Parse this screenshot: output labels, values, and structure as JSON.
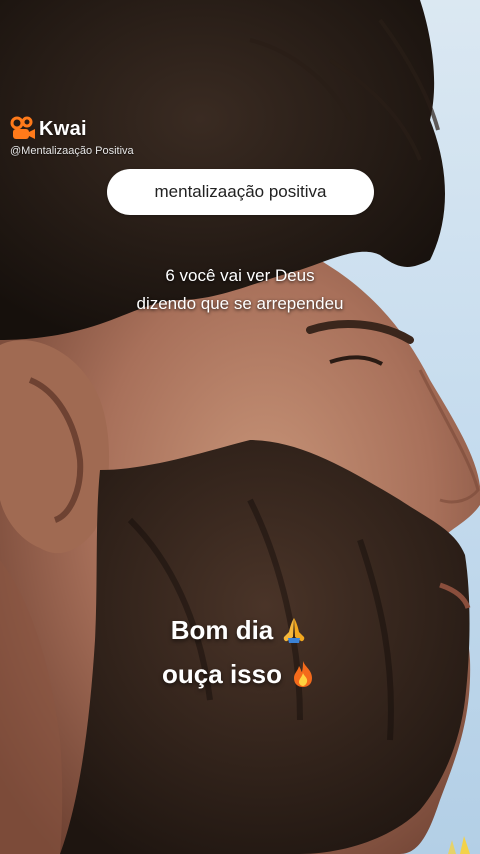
{
  "watermark": {
    "brand": "Kwai",
    "handle": "@Mentalizaação Positiva"
  },
  "pill_label": "mentalizaação positiva",
  "subtitle": {
    "line1": "6 você vai ver Deus",
    "line2": "dizendo que se arrependeu"
  },
  "caption": {
    "line1": "Bom dia",
    "line1_icon": "praying-hands-icon",
    "line2": "ouça isso",
    "line2_icon": "fire-icon"
  },
  "colors": {
    "kwai_orange": "#ff7a1a",
    "pill_bg": "#ffffff",
    "sky": "#c9dff0"
  }
}
